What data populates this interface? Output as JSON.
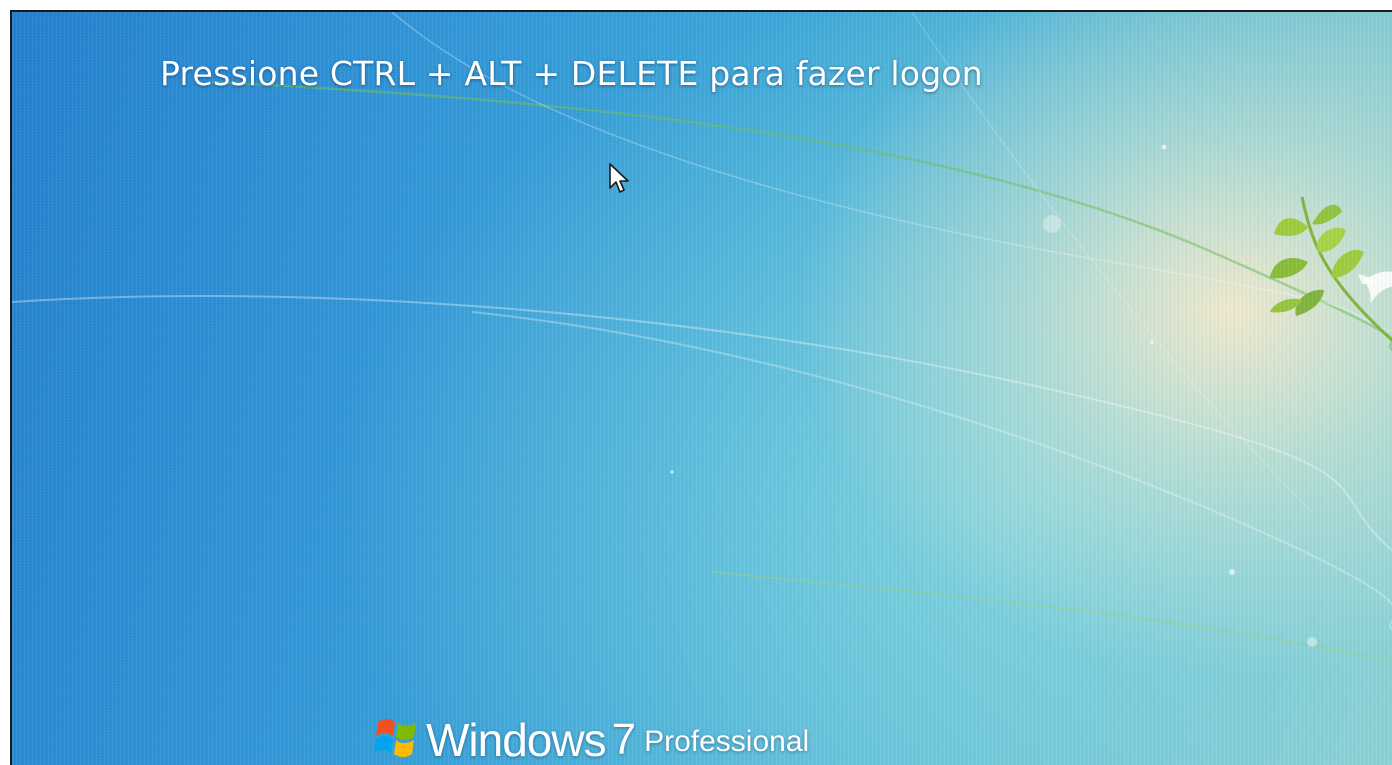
{
  "screen": {
    "logon_prompt": "Pressione CTRL + ALT + DELETE para fazer logon",
    "cursor_icon": "mouse-pointer-arrow"
  },
  "branding": {
    "logo_icon": "windows-flag-logo",
    "product_name": "Windows",
    "product_version": "7",
    "edition": "Professional"
  },
  "wallpaper": {
    "decoration": "green-leaf-branch-with-white-bird",
    "colors": {
      "deep_blue": "#1f7fcf",
      "teal": "#5cbcd6",
      "glow": "#f5ebcd",
      "leaf_green": "#8fc23a"
    }
  }
}
